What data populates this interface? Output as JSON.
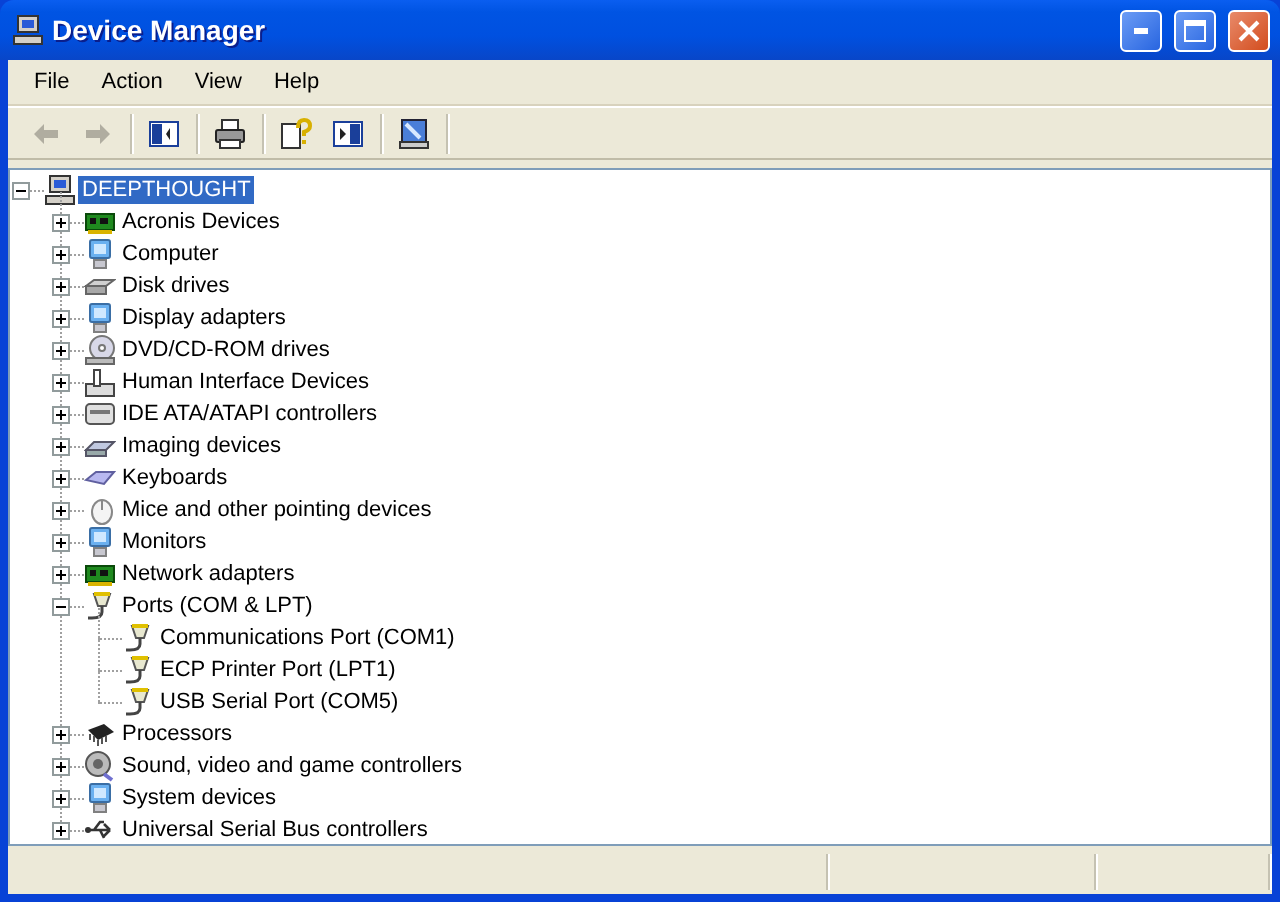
{
  "window": {
    "title": "Device Manager"
  },
  "menu": [
    "File",
    "Action",
    "View",
    "Help"
  ],
  "toolbar_groups": [
    {
      "buttons": [
        {
          "kind": "back",
          "disabled": true
        },
        {
          "kind": "forward",
          "disabled": true
        }
      ]
    },
    {
      "buttons": [
        {
          "kind": "tree",
          "disabled": false
        }
      ]
    },
    {
      "buttons": [
        {
          "kind": "print",
          "disabled": false
        }
      ]
    },
    {
      "buttons": [
        {
          "kind": "properties",
          "disabled": false
        },
        {
          "kind": "pane",
          "disabled": false
        }
      ]
    },
    {
      "buttons": [
        {
          "kind": "scan",
          "disabled": false
        }
      ]
    }
  ],
  "tree": {
    "label": "DEEPTHOUGHT",
    "kind": "computer",
    "expanded": true,
    "selected": true,
    "children": [
      {
        "label": "Acronis Devices",
        "kind": "card",
        "expanded": false,
        "selected": false
      },
      {
        "label": "Computer",
        "kind": "monitor",
        "expanded": false,
        "selected": false
      },
      {
        "label": "Disk drives",
        "kind": "disk",
        "expanded": false,
        "selected": false
      },
      {
        "label": "Display adapters",
        "kind": "monitor",
        "expanded": false,
        "selected": false
      },
      {
        "label": "DVD/CD-ROM drives",
        "kind": "dvd",
        "expanded": false,
        "selected": false
      },
      {
        "label": "Human Interface Devices",
        "kind": "hid",
        "expanded": false,
        "selected": false
      },
      {
        "label": "IDE ATA/ATAPI controllers",
        "kind": "ide",
        "expanded": false,
        "selected": false
      },
      {
        "label": "Imaging devices",
        "kind": "imaging",
        "expanded": false,
        "selected": false
      },
      {
        "label": "Keyboards",
        "kind": "keyboard",
        "expanded": false,
        "selected": false
      },
      {
        "label": "Mice and other pointing devices",
        "kind": "mouse",
        "expanded": false,
        "selected": false
      },
      {
        "label": "Monitors",
        "kind": "monitor",
        "expanded": false,
        "selected": false
      },
      {
        "label": "Network adapters",
        "kind": "card",
        "expanded": false,
        "selected": false
      },
      {
        "label": "Ports (COM & LPT)",
        "kind": "port",
        "expanded": true,
        "selected": false,
        "children": [
          {
            "label": "Communications Port (COM1)",
            "kind": "port",
            "selected": false
          },
          {
            "label": "ECP Printer Port (LPT1)",
            "kind": "port",
            "selected": false
          },
          {
            "label": "USB Serial Port (COM5)",
            "kind": "port",
            "selected": false
          }
        ]
      },
      {
        "label": "Processors",
        "kind": "cpu",
        "expanded": false,
        "selected": false
      },
      {
        "label": "Sound, video and game controllers",
        "kind": "sound",
        "expanded": false,
        "selected": false
      },
      {
        "label": "System devices",
        "kind": "monitor",
        "expanded": false,
        "selected": false
      },
      {
        "label": "Universal Serial Bus controllers",
        "kind": "usb",
        "expanded": false,
        "selected": false
      }
    ]
  }
}
